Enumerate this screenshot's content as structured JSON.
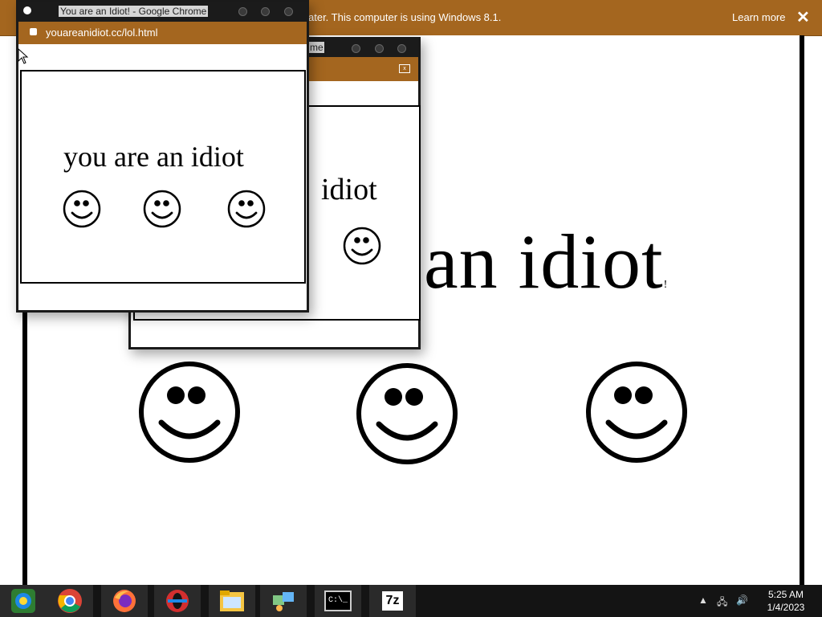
{
  "notification": {
    "message": "ater. This computer is using Windows 8.1.",
    "learn_more": "Learn more",
    "close": "✕"
  },
  "background_page": {
    "text": "an idiot",
    "tail": "!"
  },
  "window_back": {
    "title_fragment": "me",
    "text": "idiot"
  },
  "window_front": {
    "title": "You are an Idiot! - Google Chrome",
    "url": "youareanidiot.cc/lol.html",
    "text": "you are an idiot"
  },
  "taskbar": {
    "apps": [
      "windows-media-center-icon",
      "chrome-icon",
      "firefox-icon",
      "opera-icon",
      "file-explorer-icon",
      "network-icon",
      "cmd-icon",
      "7zip-icon"
    ],
    "cmd_label": "C:\\_",
    "sevenzip_label": "7z",
    "time": "5:25 AM",
    "date": "1/4/2023"
  },
  "colors": {
    "brand": "#a4661f",
    "titlebar": "#1b1b1b",
    "taskbar": "#141414"
  }
}
